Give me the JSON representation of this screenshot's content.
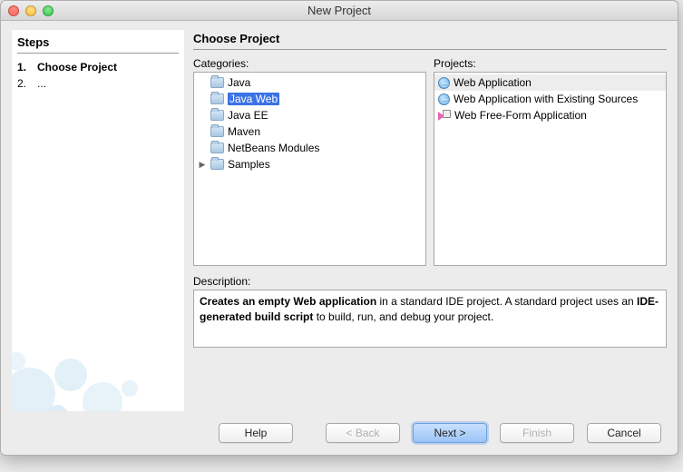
{
  "window": {
    "title": "New Project"
  },
  "steps": {
    "header": "Steps",
    "items": [
      {
        "num": "1.",
        "label": "Choose Project",
        "current": true
      },
      {
        "num": "2.",
        "label": "...",
        "current": false
      }
    ]
  },
  "rightPanel": {
    "header": "Choose Project",
    "categoriesLabel": "Categories:",
    "projectsLabel": "Projects:"
  },
  "categories": [
    {
      "label": "Java",
      "selected": false,
      "expandable": false
    },
    {
      "label": "Java Web",
      "selected": true,
      "expandable": false
    },
    {
      "label": "Java EE",
      "selected": false,
      "expandable": false
    },
    {
      "label": "Maven",
      "selected": false,
      "expandable": false
    },
    {
      "label": "NetBeans Modules",
      "selected": false,
      "expandable": false
    },
    {
      "label": "Samples",
      "selected": false,
      "expandable": true
    }
  ],
  "projects": [
    {
      "label": "Web Application",
      "icon": "globe",
      "selected": true
    },
    {
      "label": "Web Application with Existing Sources",
      "icon": "globe",
      "selected": false
    },
    {
      "label": "Web Free-Form Application",
      "icon": "freeform",
      "selected": false
    }
  ],
  "description": {
    "label": "Description:",
    "part1_bold": "Creates an empty Web application",
    "part2": " in a standard IDE project. A standard project uses an ",
    "part3_bold": "IDE-generated build script",
    "part4": " to build, run, and debug your project."
  },
  "buttons": {
    "help": "Help",
    "back": "< Back",
    "next": "Next >",
    "finish": "Finish",
    "cancel": "Cancel"
  }
}
